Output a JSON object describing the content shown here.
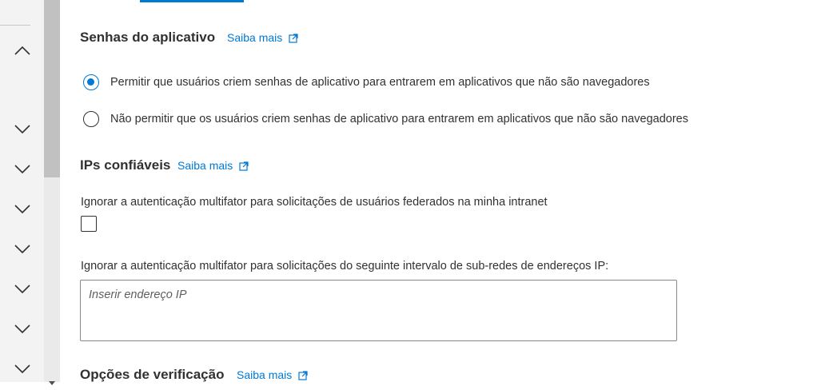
{
  "sections": {
    "app_passwords": {
      "title": "Senhas do aplicativo",
      "learn_more": "Saiba mais",
      "options": [
        {
          "label": "Permitir que usuários criem senhas de aplicativo para entrarem em aplicativos que não são navegadores",
          "selected": true
        },
        {
          "label": "Não permitir que os usuários criem senhas de aplicativo para entrarem em aplicativos que não são navegadores",
          "selected": false
        }
      ]
    },
    "trusted_ips": {
      "title": "IPs confiáveis",
      "learn_more": "Saiba mais",
      "skip_federated_label": "Ignorar a autenticação multifator para solicitações de usuários federados na minha intranet",
      "skip_federated_checked": false,
      "ip_range_label": "Ignorar a autenticação multifator para solicitações do seguinte intervalo de sub-redes de endereços IP:",
      "ip_range_placeholder": "Inserir endereço IP",
      "ip_range_value": ""
    },
    "verification_options": {
      "title": "Opções de verificação",
      "learn_more": "Saiba mais"
    }
  },
  "icons": {
    "external_link": "external-link-icon",
    "chevron_up": "chevron-up-icon",
    "chevron_down": "chevron-down-icon"
  },
  "colors": {
    "accent": "#0078d4",
    "text": "#323130",
    "sidebar_bg": "#f3f3f3",
    "scrollbar_thumb": "#c1c1c1"
  }
}
